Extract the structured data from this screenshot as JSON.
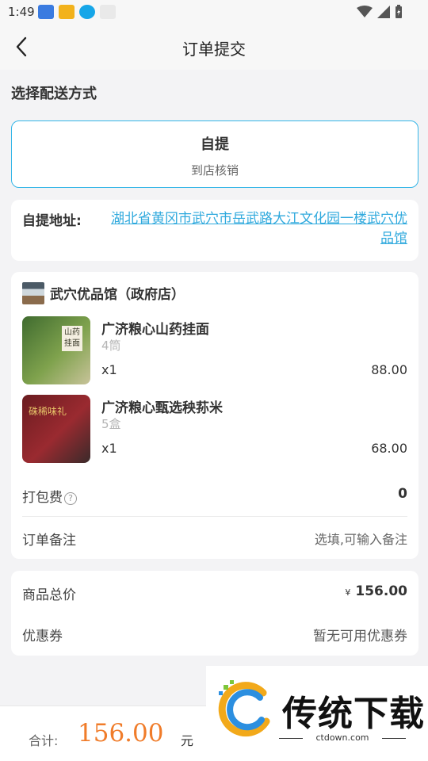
{
  "status_bar": {
    "time": "1:49"
  },
  "nav": {
    "title": "订单提交"
  },
  "delivery": {
    "section_title": "选择配送方式",
    "option_title": "自提",
    "option_subtitle": "到店核销"
  },
  "address": {
    "label": "自提地址:",
    "value": "湖北省黄冈市武穴市岳武路大江文化园一楼武穴优品馆"
  },
  "store": {
    "name": "武穴优品馆（政府店）",
    "products": [
      {
        "name": "广济粮心山药挂面",
        "spec": "4筒",
        "qty": "x1",
        "price": "88.00",
        "img_text": "山药挂面"
      },
      {
        "name": "广济粮心甄选秧荪米",
        "spec": "5盒",
        "qty": "x1",
        "price": "68.00",
        "img_text": "硃稀味礼"
      }
    ],
    "packing_fee_label": "打包费",
    "packing_fee_value": "0",
    "note_label": "订单备注",
    "note_placeholder": "选填,可输入备注"
  },
  "totals": {
    "goods_total_label": "商品总价",
    "currency_symbol": "¥",
    "goods_total_value": "156.00",
    "coupon_label": "优惠券",
    "coupon_value": "暂无可用优惠券"
  },
  "bottom_bar": {
    "sum_label": "合计:",
    "sum_amount": "156.00",
    "sum_unit": "元"
  },
  "watermark": {
    "text": "传统下载",
    "url": "ctdown.com"
  },
  "colors": {
    "accent": "#35b6e8",
    "link": "#2fa9dd",
    "price": "#f07c2a"
  }
}
